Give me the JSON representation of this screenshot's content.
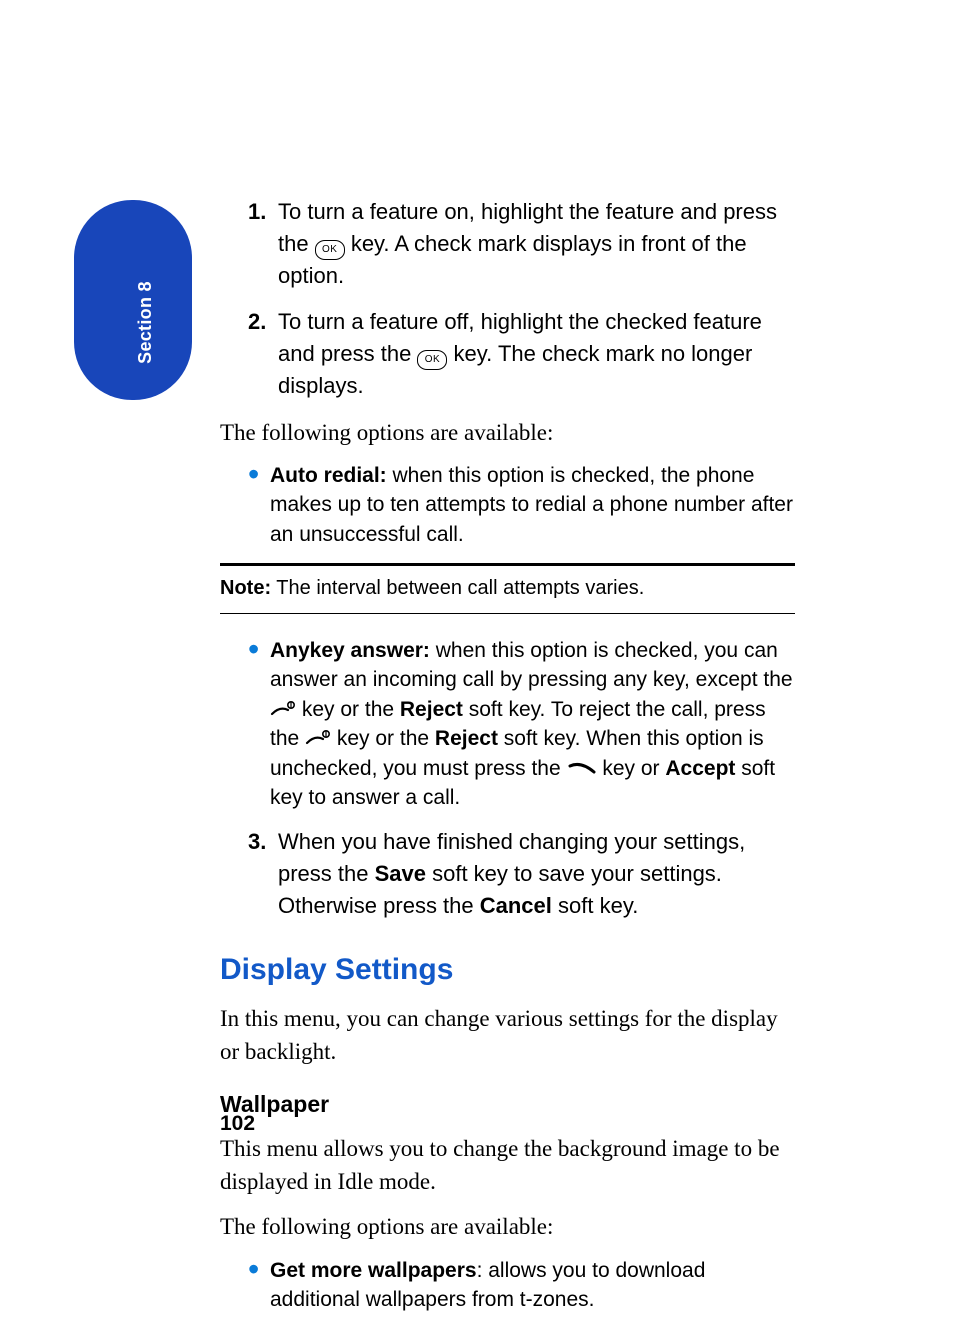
{
  "tab": {
    "label": "Section 8"
  },
  "steps_top": [
    {
      "num": "1.",
      "before": "To turn a feature on, highlight the feature and press the ",
      "after": " key. A check mark displays in front of the option.",
      "icon_text": "OK"
    },
    {
      "num": "2.",
      "before": "To turn a feature off, highlight the checked feature and press the ",
      "after": " key. The check mark no longer displays.",
      "icon_text": "OK"
    }
  ],
  "intro_line": "The following options are available:",
  "bullets_top": {
    "title": "Auto redial:",
    "text": " when this option is checked, the phone makes up to ten attempts to redial a phone number after an unsuccessful call."
  },
  "note": {
    "label": "Note:",
    "text": " The interval between call attempts varies."
  },
  "anykey": {
    "title": "Anykey answer:",
    "seg1": " when this option is checked, you can answer an incoming call by pressing any key, except the ",
    "seg2": " key or the ",
    "reject1": "Reject",
    "seg3": " soft key. To reject the call, press the ",
    "seg4": " key or the ",
    "reject2": "Reject",
    "seg5": " soft key. When this option is unchecked, you must press the ",
    "seg6": " key or ",
    "accept": "Accept",
    "seg7": " soft key to answer a call."
  },
  "step3": {
    "num": "3.",
    "a": "When you have finished changing your settings, press the ",
    "save": "Save",
    "b": " soft key to save your settings. Otherwise press the ",
    "cancel": "Cancel",
    "c": " soft key."
  },
  "display_heading": "Display Settings",
  "display_intro": "In this menu, you can change various settings for the display or backlight.",
  "wallpaper_heading": "Wallpaper",
  "wallpaper_intro": "This menu allows you to change the background image to be displayed in Idle mode.",
  "wallpaper_avail": "The following options are available:",
  "bullets_wall": {
    "title": "Get more wallpapers",
    "text": ": allows you to download additional wallpapers from t-zones."
  },
  "page_number": "102"
}
